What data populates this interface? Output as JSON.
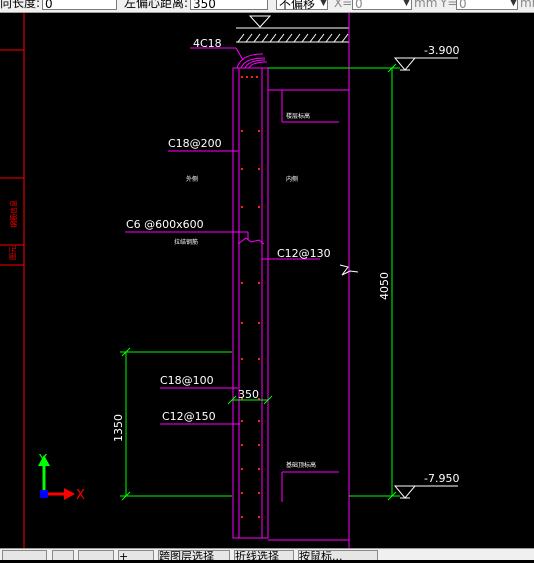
{
  "toolbar": {
    "length_label": "向长度:",
    "length_value": "0",
    "offset_label": "左偏心距离:",
    "offset_value": "350",
    "mode_value": "不偏移",
    "x_label": "X=",
    "x_value": "0",
    "unit_mm": "mm",
    "y_label": "Y=",
    "y_value": "0",
    "unit_mm2": "mm"
  },
  "left_panel": {
    "tab_label": "钢筋信息",
    "tab2_label": "图元"
  },
  "drawing": {
    "top_rebar": "4C18",
    "elev_top": "-3.900",
    "elev_bottom": "-7.950",
    "rebar_vertical": "C18@200",
    "rebar_tie": "C6 @600x600",
    "rebar_horizontal": "C12@130",
    "rebar_lower_vertical": "C18@100",
    "rebar_lower_horizontal": "C12@150",
    "width_dim": "350",
    "height_dim": "4050",
    "lower_dim": "1350",
    "note_top": "楼层标高",
    "note_mid_left": "外侧",
    "note_mid_right": "内侧",
    "note_tie": "拉结钢筋",
    "note_bottom": "基础顶标高",
    "axis_x": "X",
    "axis_y": "Y"
  },
  "bottombar": {
    "btn1": "",
    "btn2": "",
    "btn3": "",
    "btn4": "+",
    "btn5": "跨图层选择",
    "btn6": "折线选择",
    "btn7": "按鼠标..."
  },
  "colors": {
    "magenta": "#ff00ff",
    "green": "#00ff00",
    "white": "#ffffff",
    "red": "#ff0000",
    "blue": "#0000ff"
  }
}
